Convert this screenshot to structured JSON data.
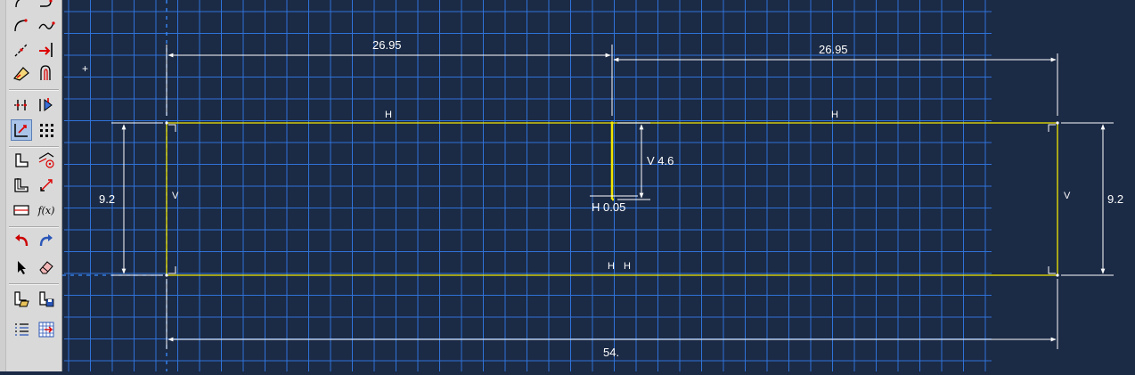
{
  "toolbox": {
    "tools": [
      {
        "name": "arc-tools-icon"
      },
      {
        "name": "fillet-icon"
      },
      {
        "name": "spline-icon"
      },
      {
        "name": "construction-line-icon"
      },
      {
        "name": "offset-icon"
      },
      {
        "name": "trim-extend-icon"
      },
      {
        "name": "dimension-icon"
      },
      {
        "name": "mirror-icon"
      },
      {
        "name": "add-constraint-icon"
      },
      {
        "name": "grid-options-icon"
      },
      {
        "name": "edit-dimension-icon"
      },
      {
        "name": "auto-trim-icon"
      },
      {
        "name": "translate-icon"
      },
      {
        "name": "measure-icon"
      },
      {
        "name": "parameter-manager-icon"
      },
      {
        "name": "function-icon",
        "label": "f(x)"
      },
      {
        "name": "undo-icon"
      },
      {
        "name": "redo-icon"
      },
      {
        "name": "select-arrow-icon"
      },
      {
        "name": "eraser-icon"
      },
      {
        "name": "open-sketch-icon"
      },
      {
        "name": "save-sketch-icon"
      },
      {
        "name": "sketch-options-icon"
      },
      {
        "name": "grid-icon"
      }
    ]
  },
  "sketch": {
    "crosshair": "+",
    "dimensions": {
      "top_left_length": "26.95",
      "top_right_length": "26.95",
      "left_height": "9.2",
      "right_height": "9.2",
      "slot_depth": "V 4.6",
      "slot_width": "H 0.05",
      "total_width": "54."
    },
    "constraints": {
      "top_left_h": "H",
      "top_right_h": "H",
      "left_v": "V",
      "right_v": "V",
      "bottom_h1": "H",
      "bottom_h2": "H"
    },
    "colors": {
      "background": "#1b2a45",
      "grid": "#2f73d9",
      "geometry": "#f2e600",
      "dimension": "#ffffff"
    }
  }
}
